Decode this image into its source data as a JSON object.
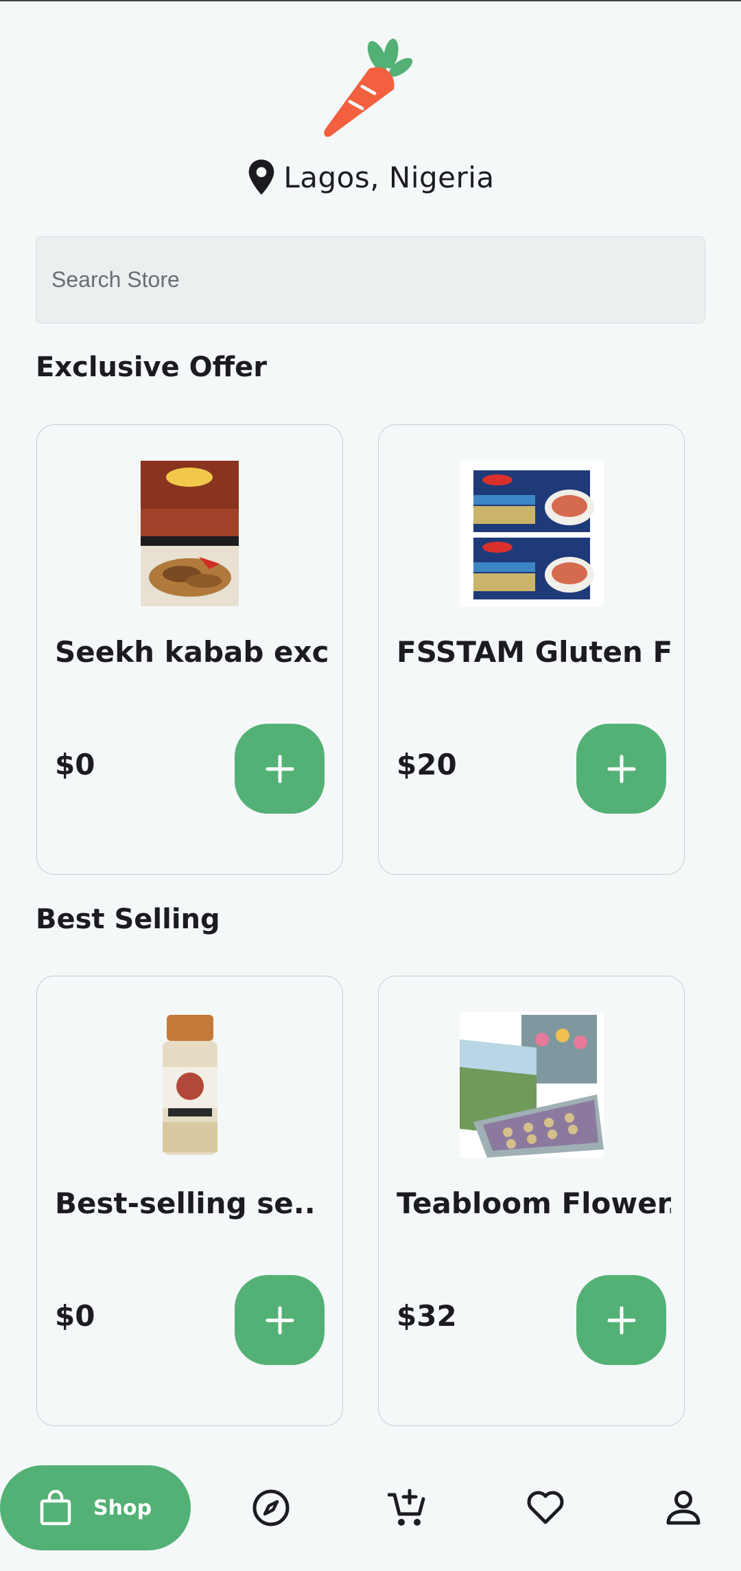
{
  "header": {
    "logo_icon": "carrot-icon",
    "location_icon": "map-pin-icon",
    "location": "Lagos, Nigeria"
  },
  "search": {
    "placeholder": "Search Store",
    "value": ""
  },
  "sections": [
    {
      "title": "Exclusive Offer",
      "products": [
        {
          "name": "Seekh kabab exc..",
          "price": "$0",
          "image_icon": "spice-box-image"
        },
        {
          "name": "FSSTAM Gluten F..",
          "price": "$20",
          "image_icon": "lasagne-box-image"
        }
      ]
    },
    {
      "title": "Best Selling",
      "products": [
        {
          "name": "Best-selling se..",
          "price": "$0",
          "image_icon": "seasoning-jar-image"
        },
        {
          "name": "Teabloom Flower..",
          "price": "$32",
          "image_icon": "tea-gift-box-image"
        }
      ]
    }
  ],
  "bottom_nav": {
    "items": [
      {
        "label": "Shop",
        "icon": "shopping-bag-icon",
        "active": true
      },
      {
        "label": "",
        "icon": "compass-icon",
        "active": false
      },
      {
        "label": "",
        "icon": "cart-add-icon",
        "active": false
      },
      {
        "label": "",
        "icon": "heart-icon",
        "active": false
      },
      {
        "label": "",
        "icon": "person-icon",
        "active": false
      }
    ]
  },
  "colors": {
    "accent": "#53b175",
    "background": "#f5f8f9",
    "carrot": "#f3603f",
    "text": "#1c1b22"
  }
}
